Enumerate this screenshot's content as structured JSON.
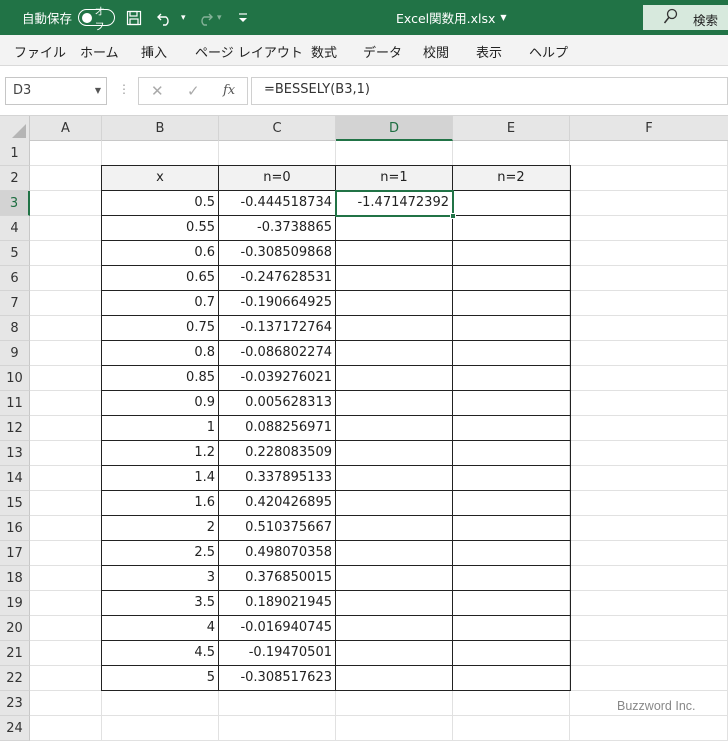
{
  "titlebar": {
    "autosave_label": "自動保存",
    "autosave_toggle": "オフ",
    "doc_title": "Excel関数用.xlsx",
    "search_label": "検索",
    "accent": "#217346"
  },
  "menu": [
    "ファイル",
    "ホーム",
    "挿入",
    "ページ レイアウト",
    "数式",
    "データ",
    "校閲",
    "表示",
    "ヘルプ"
  ],
  "formula_bar": {
    "name_box": "D3",
    "formula": "=BESSELY(B3,1)",
    "fx_label": "fx"
  },
  "sheet": {
    "columns": [
      "A",
      "B",
      "C",
      "D",
      "E",
      "F"
    ],
    "active_column": "D",
    "active_row": 3,
    "rows": [
      "1",
      "2",
      "3",
      "4",
      "5",
      "6",
      "7",
      "8",
      "9",
      "10",
      "11",
      "12",
      "13",
      "14",
      "15",
      "16",
      "17",
      "18",
      "19",
      "20",
      "21",
      "22",
      "23",
      "24"
    ],
    "headers": [
      "x",
      "n=0",
      "n=1",
      "n=2"
    ],
    "data": [
      {
        "x": "0.5",
        "n0": "-0.444518734",
        "n1": "-1.471472392",
        "n2": ""
      },
      {
        "x": "0.55",
        "n0": "-0.3738865",
        "n1": "",
        "n2": ""
      },
      {
        "x": "0.6",
        "n0": "-0.308509868",
        "n1": "",
        "n2": ""
      },
      {
        "x": "0.65",
        "n0": "-0.247628531",
        "n1": "",
        "n2": ""
      },
      {
        "x": "0.7",
        "n0": "-0.190664925",
        "n1": "",
        "n2": ""
      },
      {
        "x": "0.75",
        "n0": "-0.137172764",
        "n1": "",
        "n2": ""
      },
      {
        "x": "0.8",
        "n0": "-0.086802274",
        "n1": "",
        "n2": ""
      },
      {
        "x": "0.85",
        "n0": "-0.039276021",
        "n1": "",
        "n2": ""
      },
      {
        "x": "0.9",
        "n0": "0.005628313",
        "n1": "",
        "n2": ""
      },
      {
        "x": "1",
        "n0": "0.088256971",
        "n1": "",
        "n2": ""
      },
      {
        "x": "1.2",
        "n0": "0.228083509",
        "n1": "",
        "n2": ""
      },
      {
        "x": "1.4",
        "n0": "0.337895133",
        "n1": "",
        "n2": ""
      },
      {
        "x": "1.6",
        "n0": "0.420426895",
        "n1": "",
        "n2": ""
      },
      {
        "x": "2",
        "n0": "0.510375667",
        "n1": "",
        "n2": ""
      },
      {
        "x": "2.5",
        "n0": "0.498070358",
        "n1": "",
        "n2": ""
      },
      {
        "x": "3",
        "n0": "0.376850015",
        "n1": "",
        "n2": ""
      },
      {
        "x": "3.5",
        "n0": "0.189021945",
        "n1": "",
        "n2": ""
      },
      {
        "x": "4",
        "n0": "-0.016940745",
        "n1": "",
        "n2": ""
      },
      {
        "x": "4.5",
        "n0": "-0.19470501",
        "n1": "",
        "n2": ""
      },
      {
        "x": "5",
        "n0": "-0.308517623",
        "n1": "",
        "n2": ""
      }
    ]
  },
  "watermark": "Buzzword Inc."
}
